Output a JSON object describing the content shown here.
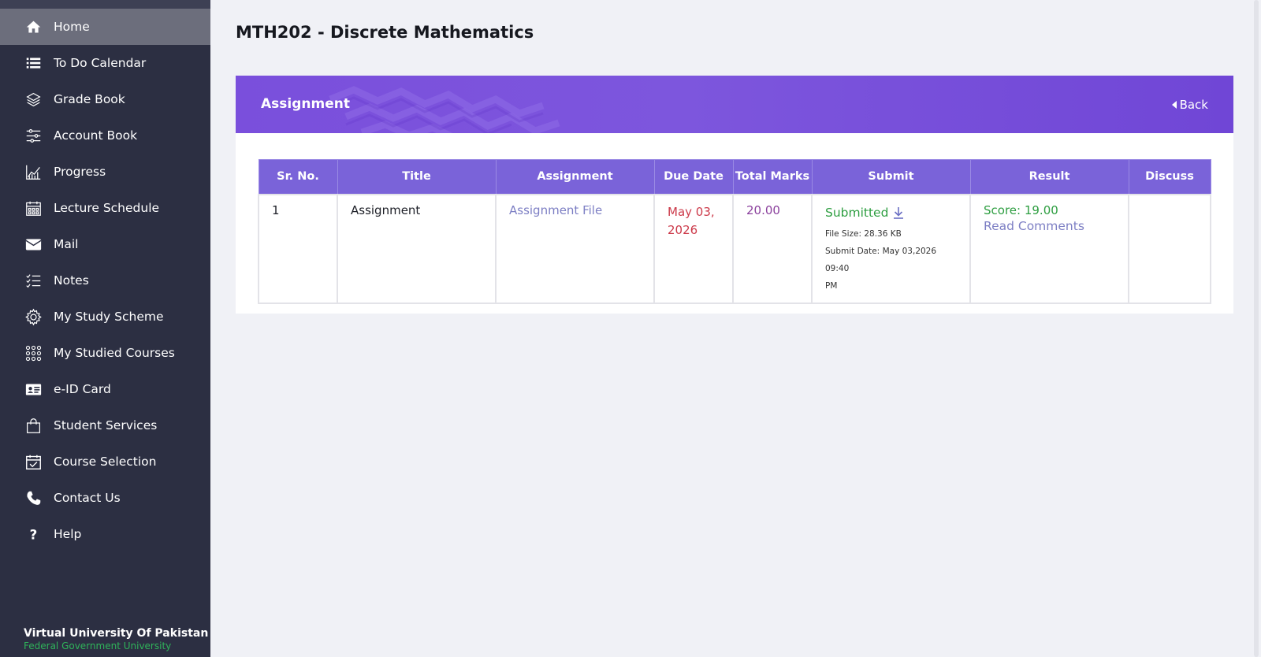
{
  "sidebar": {
    "items": [
      {
        "label": "Home",
        "icon": "home-icon",
        "active": true
      },
      {
        "label": "To Do Calendar",
        "icon": "list-icon"
      },
      {
        "label": "Grade Book",
        "icon": "layers-icon"
      },
      {
        "label": "Account Book",
        "icon": "sliders-icon"
      },
      {
        "label": "Progress",
        "icon": "chart-icon"
      },
      {
        "label": "Lecture Schedule",
        "icon": "calendar-icon"
      },
      {
        "label": "Mail",
        "icon": "mail-icon"
      },
      {
        "label": "Notes",
        "icon": "checklist-icon"
      },
      {
        "label": "My Study Scheme",
        "icon": "gear-icon"
      },
      {
        "label": "My Studied Courses",
        "icon": "grid-dots-icon"
      },
      {
        "label": "e-ID Card",
        "icon": "id-card-icon"
      },
      {
        "label": "Student Services",
        "icon": "bag-icon"
      },
      {
        "label": "Course Selection",
        "icon": "calendar-check-icon"
      },
      {
        "label": "Contact Us",
        "icon": "phone-icon"
      },
      {
        "label": "Help",
        "icon": "question-icon"
      }
    ],
    "footer": {
      "name": "Virtual University Of Pakistan",
      "subtitle": "Federal Government University"
    }
  },
  "page": {
    "title": "MTH202 - Discrete Mathematics"
  },
  "card": {
    "title": "Assignment",
    "back_label": "Back"
  },
  "table": {
    "headers": [
      "Sr. No.",
      "Title",
      "Assignment",
      "Due Date",
      "Total Marks",
      "Submit",
      "Result",
      "Discuss"
    ],
    "rows": [
      {
        "sr_no": "1",
        "title": "Assignment",
        "assignment_link": "Assignment File",
        "due_date_line1": "May 03,",
        "due_date_line2": "2026",
        "total_marks": "20.00",
        "submit_status": "Submitted",
        "file_size_label": "File Size:",
        "file_size_value": "28.36 KB",
        "submit_date_label": "Submit Date:",
        "submit_date_value": "May 03,2026 09:40",
        "submit_date_suffix": "PM",
        "score": "Score: 19.00",
        "read_comments": "Read Comments",
        "discuss": ""
      }
    ]
  },
  "colors": {
    "sidebar_bg": "#2c2f42",
    "header_purple": "#7a4fdc",
    "table_header": "#7a63d9",
    "success_green": "#2e9e41",
    "due_red": "#cc3a4a"
  }
}
